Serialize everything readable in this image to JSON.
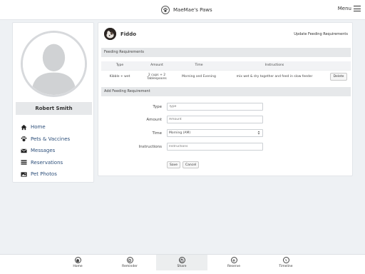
{
  "header": {
    "app_title": "MaeMae's Paws",
    "menu_label": "Menu"
  },
  "profile": {
    "name": "Robert Smith"
  },
  "sidebar": {
    "items": [
      {
        "label": "Home",
        "icon": "home-icon"
      },
      {
        "label": "Pets & Vaccines",
        "icon": "paw-icon"
      },
      {
        "label": "Messages",
        "icon": "envelope-icon"
      },
      {
        "label": "Reservations",
        "icon": "list-icon"
      },
      {
        "label": "Pet Photos",
        "icon": "photo-icon"
      }
    ]
  },
  "pet": {
    "name": "Fiddo",
    "update_link": "Update Feeding Requirements"
  },
  "feeding": {
    "section_title": "Feeding Requirements",
    "columns": [
      "Type",
      "Amount",
      "Time",
      "Instructions"
    ],
    "rows": [
      {
        "type": "Kibble + wet",
        "amount_line1": "2 cups + 2",
        "amount_line2": "Tablespoons",
        "time": "Morning and Evening",
        "instructions": "mix wet & dry together and feed in slow feeder",
        "action": "Delete"
      }
    ]
  },
  "add_form": {
    "section_title": "Add Feeding Requirement",
    "type_label": "Type",
    "type_placeholder": "Type",
    "amount_label": "Amount",
    "amount_placeholder": "Amount",
    "time_label": "Time",
    "time_value": "Morning (AM)",
    "instructions_label": "Instructions",
    "instructions_placeholder": "Instructions",
    "save_label": "Save",
    "cancel_label": "Cancel"
  },
  "bottom_nav": {
    "tabs": [
      {
        "label": "Home",
        "icon": "home-circle-icon"
      },
      {
        "label": "Reminder",
        "icon": "gear-icon"
      },
      {
        "label": "Share",
        "icon": "share-icon",
        "active": true
      },
      {
        "label": "Reserve",
        "icon": "plus-icon"
      },
      {
        "label": "Timeline",
        "icon": "timeline-icon"
      }
    ]
  }
}
